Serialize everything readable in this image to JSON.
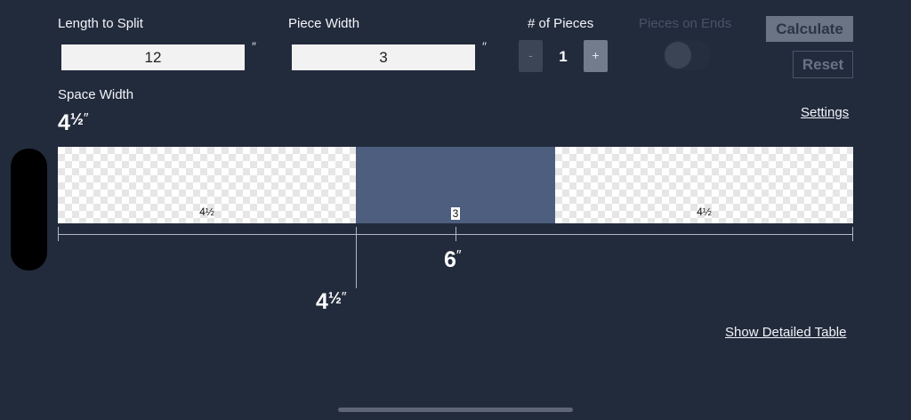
{
  "inputs": {
    "length_label": "Length to Split",
    "length_value": "12",
    "piece_width_label": "Piece Width",
    "piece_width_value": "3",
    "unit_symbol": "″"
  },
  "pieces": {
    "label": "# of Pieces",
    "count": "1",
    "minus": "-",
    "plus": "+"
  },
  "ends": {
    "label": "Pieces on Ends",
    "enabled": false
  },
  "buttons": {
    "calculate": "Calculate",
    "reset": "Reset"
  },
  "space": {
    "label": "Space Width",
    "whole": "4",
    "fraction": "½",
    "unit": "″"
  },
  "links": {
    "settings": "Settings",
    "detailed_table": "Show Detailed Table"
  },
  "diagram": {
    "total_length": 12,
    "segments": [
      {
        "kind": "space",
        "width": 4.5,
        "label": "4½"
      },
      {
        "kind": "piece",
        "width": 3,
        "label": "3"
      },
      {
        "kind": "space",
        "width": 4.5,
        "label": "4½"
      }
    ],
    "center_mark": {
      "whole": "6",
      "fraction": "",
      "unit": "″"
    },
    "edge_mark": {
      "whole": "4",
      "fraction": "½",
      "unit": "″"
    }
  },
  "colors": {
    "background": "#222b3c",
    "piece": "#4e5e7e",
    "calculate_bg": "#6b7485"
  }
}
